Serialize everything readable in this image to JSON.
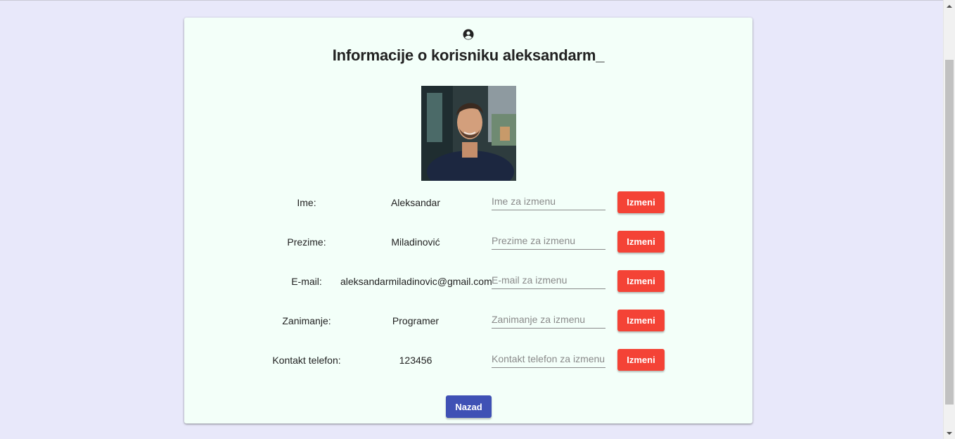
{
  "profile": {
    "title": "Informacije o korisniku aleksandarm_",
    "icon": "account-circle-icon"
  },
  "fields": [
    {
      "label": "Ime:",
      "value": "Aleksandar",
      "placeholder": "Ime za izmenu",
      "button": "Izmeni"
    },
    {
      "label": "Prezime:",
      "value": "Miladinović",
      "placeholder": "Prezime za izmenu",
      "button": "Izmeni"
    },
    {
      "label": "E-mail:",
      "value": "aleksandarmiladinovic@gmail.com",
      "placeholder": "E-mail za izmenu",
      "button": "Izmeni"
    },
    {
      "label": "Zanimanje:",
      "value": "Programer",
      "placeholder": "Zanimanje za izmenu",
      "button": "Izmeni"
    },
    {
      "label": "Kontakt telefon:",
      "value": "123456",
      "placeholder": "Kontakt telefon za izmenu",
      "button": "Izmeni"
    }
  ],
  "actions": {
    "back_label": "Nazad"
  },
  "colors": {
    "background": "#e8e8fa",
    "card": "#f3fff9",
    "edit_button": "#f44336",
    "back_button": "#3f51b5"
  }
}
